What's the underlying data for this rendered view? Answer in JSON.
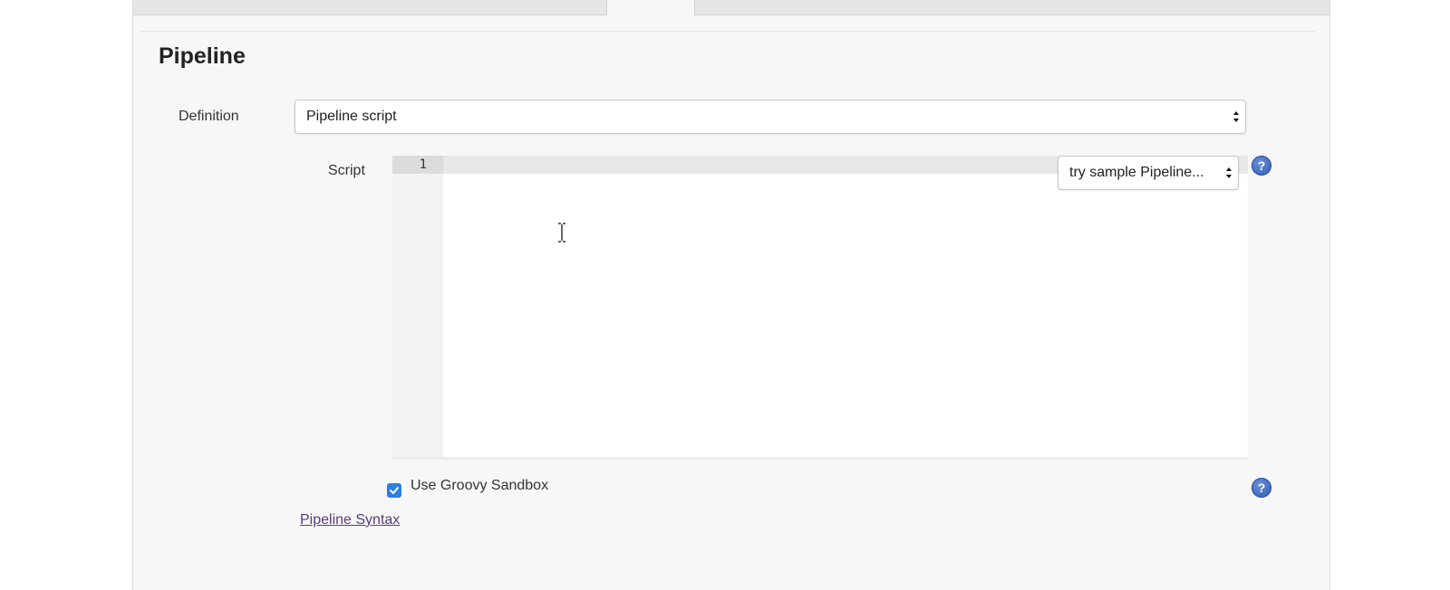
{
  "section": {
    "title": "Pipeline"
  },
  "definition": {
    "label": "Definition",
    "selected": "Pipeline script"
  },
  "script": {
    "label": "Script",
    "line_numbers": [
      "1"
    ],
    "sample_select": "try sample Pipeline...",
    "help_icon": "question-icon"
  },
  "sandbox": {
    "label": "Use Groovy Sandbox",
    "checked": true,
    "help_icon": "question-icon"
  },
  "links": {
    "pipeline_syntax": "Pipeline Syntax"
  },
  "colors": {
    "accent": "#2f7de1",
    "help_icon": "#2d5bb0",
    "link": "#5a3e7a"
  }
}
